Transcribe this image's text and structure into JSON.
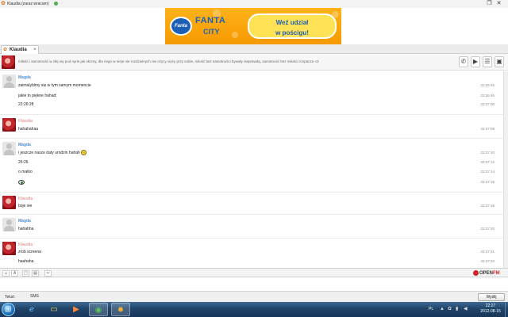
{
  "titlebar": {
    "title": "Klaudia (zaraz wracam)"
  },
  "banner": {
    "fanta": "FANTA",
    "city": "CITY",
    "cta_line1": "Weź udział",
    "cta_line2": "w pościgu!"
  },
  "tab": {
    "label": "Klaudia",
    "close": "×"
  },
  "contact": {
    "description": "miłość i samotność w złej się pod nyrie jak skrzny, dla nego w nieje nie rozdzielnych nie ożycy cięży przy sobie, miłość bez samotności bywały nieprawdą, samotność bez miłości rozpacza <3"
  },
  "messages": [
    {
      "sender": "Magda",
      "avatar": "grey",
      "lines": [
        {
          "text": "zaimalyblmy się w tym samym momencie",
          "time": "22:26:45"
        },
        {
          "text": "jakie to piękne hahad;",
          "time": "22:26:46"
        },
        {
          "text": "22:26:28",
          "time": "22:27:00"
        }
      ]
    },
    {
      "sender": "Klaudia",
      "avatar": "red",
      "lines": [
        {
          "text": "hahahahaa",
          "time": "22:27:08"
        }
      ]
    },
    {
      "sender": "Magda",
      "avatar": "grey",
      "lines": [
        {
          "text": "i jeszcze nasze daty urodzin hahah",
          "time": "22:27:10",
          "emote": "smile"
        },
        {
          "text": "26:26",
          "time": "22:27:12"
        },
        {
          "text": "o matko",
          "time": "22:27:14"
        },
        {
          "text": "",
          "time": "22:27:15",
          "emote": "eye"
        }
      ]
    },
    {
      "sender": "Klaudia",
      "avatar": "red",
      "lines": [
        {
          "text": "boje sie",
          "time": "22:27:18"
        }
      ]
    },
    {
      "sender": "Magda",
      "avatar": "grey",
      "lines": [
        {
          "text": "hahahha",
          "time": "22:27:20"
        }
      ]
    },
    {
      "sender": "Klaudia",
      "avatar": "red",
      "lines": [
        {
          "text": "zrob screena",
          "time": "22:27:21"
        },
        {
          "text": "haahaha",
          "time": "22:27:22"
        }
      ]
    }
  ],
  "toolbar": {
    "openfm": "OPEN",
    "openfm_suffix": "FM"
  },
  "footer": {
    "label": "Tekst:",
    "mode": "SMS",
    "send": "Wyślij"
  },
  "taskbar": {
    "lang": "PL",
    "time": "22:27",
    "date": "2012-08-15"
  }
}
